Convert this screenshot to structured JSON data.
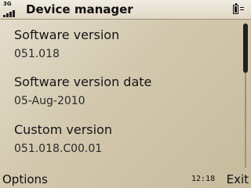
{
  "statusbar": {
    "network_label": "3G",
    "title": "Device manager",
    "battery_level": 1.0,
    "signal_bars": 4
  },
  "items": [
    {
      "label": "Software version",
      "value": "051.018"
    },
    {
      "label": "Software version date",
      "value": "05-Aug-2010"
    },
    {
      "label": "Custom version",
      "value": "051.018.C00.01"
    }
  ],
  "scroll": {
    "position": 0.0,
    "visible_fraction": 0.34
  },
  "softkeys": {
    "left": "Options",
    "right": "Exit",
    "time": "12:18"
  }
}
